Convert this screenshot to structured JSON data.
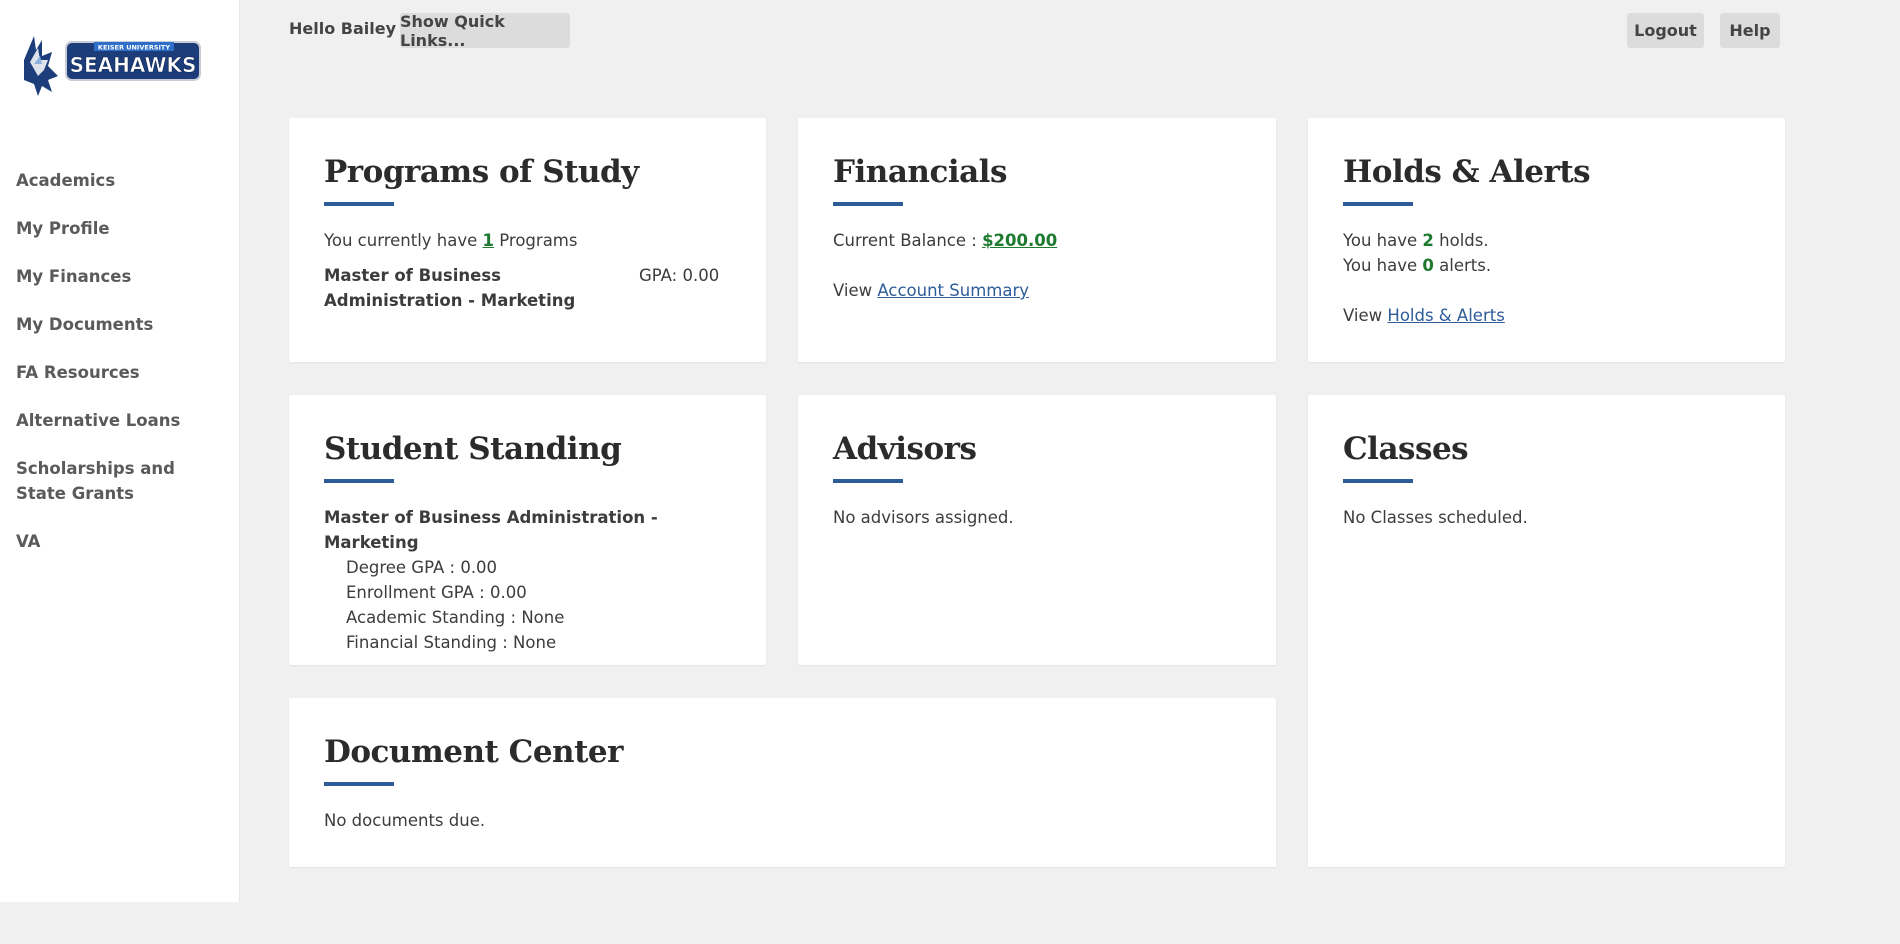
{
  "topbar": {
    "greeting": "Hello Bailey",
    "quick_links_label": "Show Quick Links...",
    "logout_label": "Logout",
    "help_label": "Help"
  },
  "logo": {
    "top_text": "KEISER UNIVERSITY",
    "main_text": "SEAHAWKS"
  },
  "sidebar": {
    "items": [
      {
        "label": "Academics"
      },
      {
        "label": "My Profile"
      },
      {
        "label": "My Finances"
      },
      {
        "label": "My Documents"
      },
      {
        "label": "FA Resources"
      },
      {
        "label": "Alternative Loans"
      },
      {
        "label": "Scholarships and State Grants"
      },
      {
        "label": "VA"
      }
    ]
  },
  "programs": {
    "title": "Programs of Study",
    "intro_pre": "You currently have ",
    "count": "1",
    "intro_post": " Programs",
    "program_name": "Master of Business Administration - Marketing",
    "gpa": "GPA: 0.00"
  },
  "financials": {
    "title": "Financials",
    "balance_label": "Current Balance : ",
    "balance_value": "$200.00",
    "view_label": "View ",
    "account_summary_link": "Account Summary"
  },
  "holds": {
    "title": "Holds & Alerts",
    "holds_pre": "You have ",
    "holds_count": "2",
    "holds_post": " holds.",
    "alerts_pre": "You have ",
    "alerts_count": "0",
    "alerts_post": " alerts.",
    "view_label": "View ",
    "holds_link": "Holds & Alerts"
  },
  "standing": {
    "title": "Student Standing",
    "program": "Master of Business Administration - Marketing",
    "degree_gpa": "Degree GPA : 0.00",
    "enrollment_gpa": "Enrollment GPA : 0.00",
    "academic_standing": "Academic Standing : None",
    "financial_standing": "Financial Standing : None"
  },
  "advisors": {
    "title": "Advisors",
    "message": "No advisors assigned."
  },
  "classes": {
    "title": "Classes",
    "message": "No Classes scheduled."
  },
  "documents": {
    "title": "Document Center",
    "message": "No documents due."
  },
  "colors": {
    "accent": "#2d5c99",
    "green": "#1d7a2f",
    "background": "#f0f0f0"
  }
}
